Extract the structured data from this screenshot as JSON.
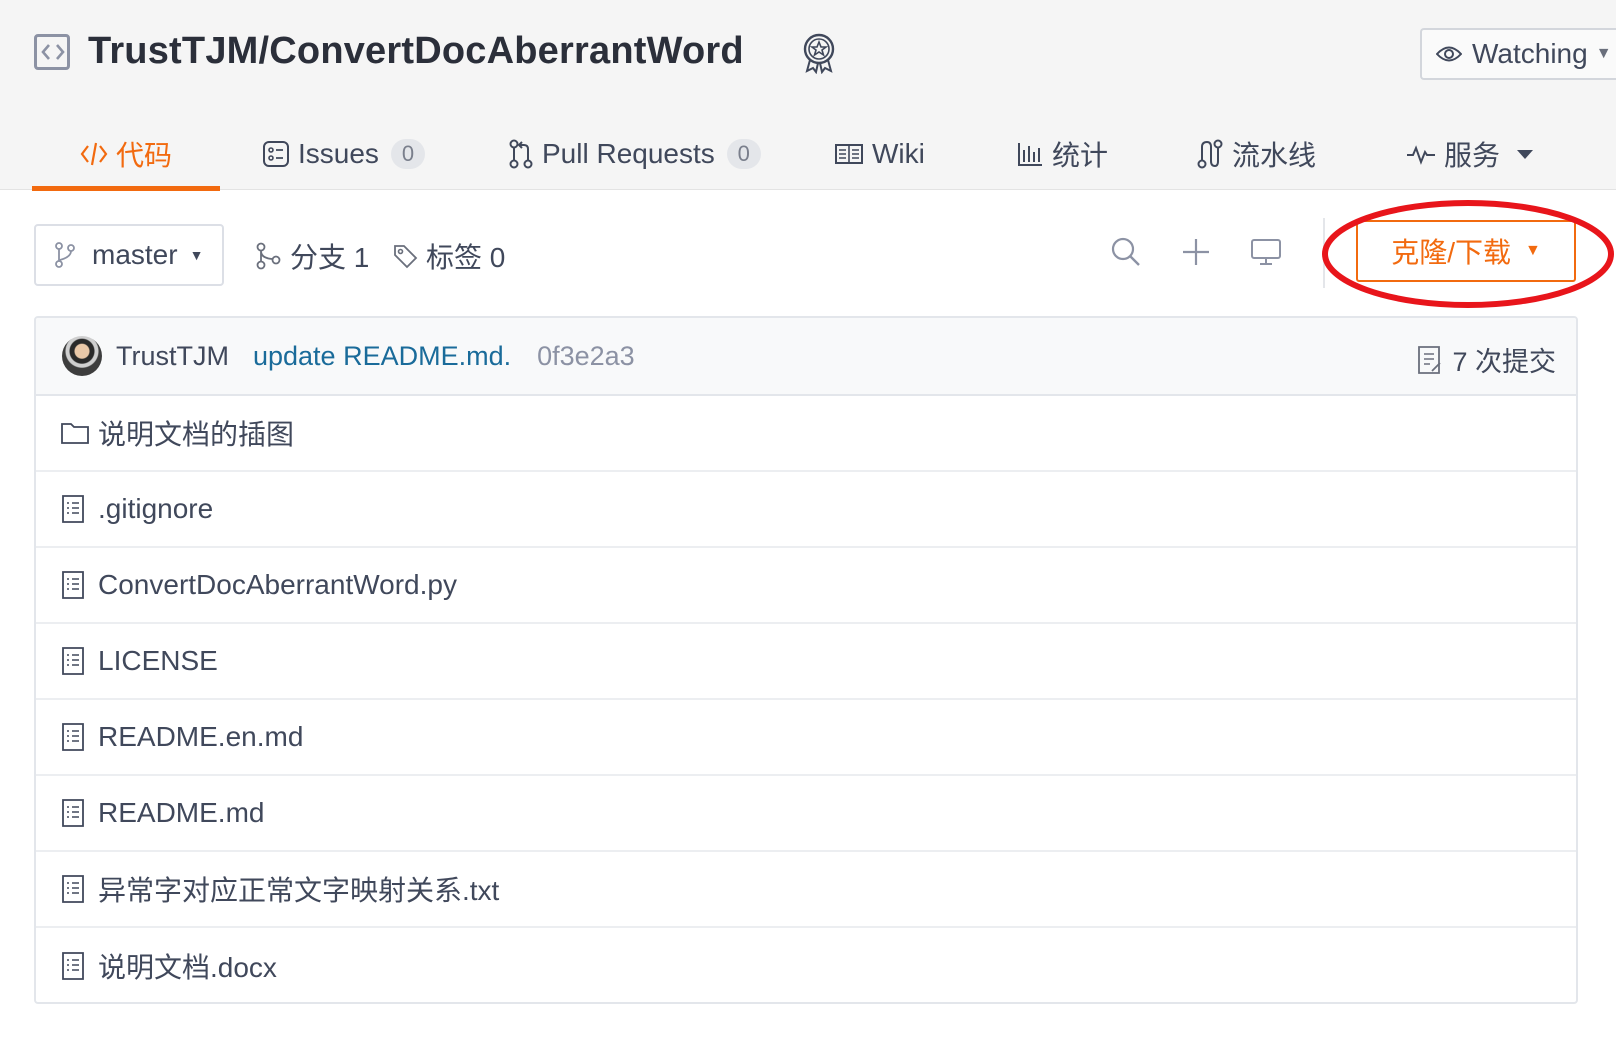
{
  "repo": {
    "title": "TrustTJM/ConvertDocAberrantWord",
    "watch_label": "Watching"
  },
  "tabs": [
    {
      "label": "代码",
      "icon": "code-icon",
      "active": true
    },
    {
      "label": "Issues",
      "icon": "issues-icon",
      "count": "0"
    },
    {
      "label": "Pull Requests",
      "icon": "pull-request-icon",
      "count": "0"
    },
    {
      "label": "Wiki",
      "icon": "wiki-icon"
    },
    {
      "label": "统计",
      "icon": "stats-icon"
    },
    {
      "label": "流水线",
      "icon": "pipeline-icon"
    },
    {
      "label": "服务",
      "icon": "pulse-icon",
      "dropdown": true
    }
  ],
  "toolbar": {
    "branch": "master",
    "branches_label": "分支 1",
    "tags_label": "标签 0",
    "clone_label": "克隆/下载"
  },
  "commit": {
    "author": "TrustTJM",
    "message": "update README.md.",
    "sha": "0f3e2a3",
    "count_label": "7 次提交"
  },
  "files": [
    {
      "name": "说明文档的插图",
      "type": "folder"
    },
    {
      "name": ".gitignore",
      "type": "file"
    },
    {
      "name": "ConvertDocAberrantWord.py",
      "type": "file"
    },
    {
      "name": "LICENSE",
      "type": "file"
    },
    {
      "name": "README.en.md",
      "type": "file"
    },
    {
      "name": "README.md",
      "type": "file"
    },
    {
      "name": "异常字对应正常文字映射关系.txt",
      "type": "file"
    },
    {
      "name": "说明文档.docx",
      "type": "file"
    }
  ],
  "colors": {
    "accent": "#f26a0f",
    "annotation": "#e8151b",
    "link": "#1a6b9a"
  }
}
